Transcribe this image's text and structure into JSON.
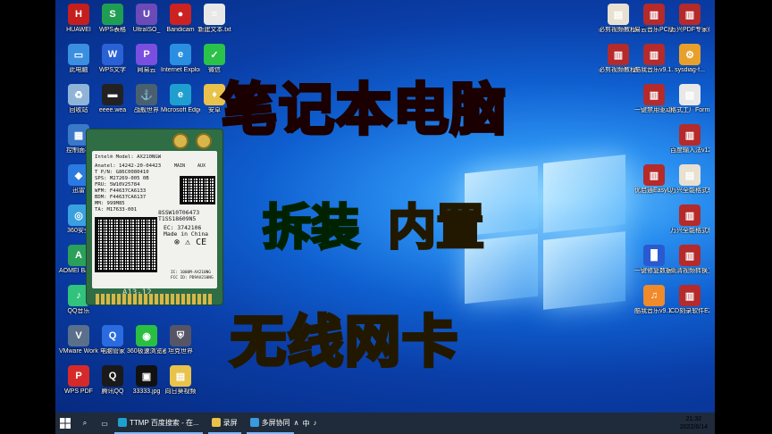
{
  "desktop_icons_left": [
    {
      "label": "HUAWEI",
      "color": "#c41e1e",
      "glyph": "H",
      "col": 0,
      "row": 0
    },
    {
      "label": "WPS表格",
      "color": "#1f9e53",
      "glyph": "S",
      "col": 1,
      "row": 0
    },
    {
      "label": "UltraISO_",
      "color": "#6a4bb8",
      "glyph": "U",
      "col": 2,
      "row": 0
    },
    {
      "label": "Bandicam",
      "color": "#c22",
      "glyph": "●",
      "col": 3,
      "row": 0
    },
    {
      "label": "新建文本.txt",
      "color": "#e8e8e8",
      "glyph": "≡",
      "col": 4,
      "row": 0
    },
    {
      "label": "此电脑",
      "color": "#3a8fe0",
      "glyph": "▭",
      "col": 0,
      "row": 1
    },
    {
      "label": "WPS文字",
      "color": "#2a62d6",
      "glyph": "W",
      "col": 1,
      "row": 1
    },
    {
      "label": "网易云",
      "color": "#7a4fe0",
      "glyph": "P",
      "col": 2,
      "row": 1
    },
    {
      "label": "Internet Explorer",
      "color": "#2a8fe0",
      "glyph": "e",
      "col": 3,
      "row": 1
    },
    {
      "label": "微信",
      "color": "#2bc24a",
      "glyph": "✓",
      "col": 4,
      "row": 1
    },
    {
      "label": "回收站",
      "color": "#8fb4d8",
      "glyph": "♻",
      "col": 0,
      "row": 2
    },
    {
      "label": "eeee.wea",
      "color": "#222",
      "glyph": "▬",
      "col": 1,
      "row": 2
    },
    {
      "label": "战舰世界",
      "color": "#4a6070",
      "glyph": "⚓",
      "col": 2,
      "row": 2
    },
    {
      "label": "Microsoft Edge",
      "color": "#1f9fd0",
      "glyph": "e",
      "col": 3,
      "row": 2
    },
    {
      "label": "安卓",
      "color": "#e8c24a",
      "glyph": "♦",
      "col": 4,
      "row": 2
    },
    {
      "label": "控制面板",
      "color": "#3a78c8",
      "glyph": "▦",
      "col": 0,
      "row": 3
    },
    {
      "label": "迅雷",
      "color": "#2a7ae0",
      "glyph": "◆",
      "col": 0,
      "row": 4
    },
    {
      "label": "360安全",
      "color": "#3aa0e0",
      "glyph": "◎",
      "col": 0,
      "row": 5
    },
    {
      "label": "AOMEI Backupper",
      "color": "#2aa05a",
      "glyph": "A",
      "col": 0,
      "row": 6
    },
    {
      "label": "QQ音乐",
      "color": "#31c27c",
      "glyph": "♪",
      "col": 0,
      "row": 7
    },
    {
      "label": "VMware Workstati",
      "color": "#5a6f8a",
      "glyph": "V",
      "col": 0,
      "row": 8
    },
    {
      "label": "电脑管家",
      "color": "#2a6ce0",
      "glyph": "Q",
      "col": 1,
      "row": 8
    },
    {
      "label": "360极速浏览器",
      "color": "#2abf40",
      "glyph": "◉",
      "col": 2,
      "row": 8
    },
    {
      "label": "坦克世界",
      "color": "#556",
      "glyph": "⛨",
      "col": 3,
      "row": 8
    },
    {
      "label": "WPS PDF",
      "color": "#d62a2a",
      "glyph": "P",
      "col": 0,
      "row": 9
    },
    {
      "label": "腾讯QQ",
      "color": "#1a1a1a",
      "glyph": "Q",
      "col": 1,
      "row": 9
    },
    {
      "label": "33333.jpg",
      "color": "#111",
      "glyph": "▣",
      "col": 2,
      "row": 9
    },
    {
      "label": "向日葵视频",
      "color": "#e8c24a",
      "glyph": "▤",
      "col": 3,
      "row": 9
    }
  ],
  "desktop_icons_right": [
    {
      "label": "必剪视频教程Bing...",
      "color": "#e8e0d0",
      "glyph": "▤",
      "col": 0,
      "row": 0
    },
    {
      "label": "易云音乐PC版_v2.7.5...",
      "color": "#b52a2a",
      "glyph": "▥",
      "col": 1,
      "row": 0
    },
    {
      "label": "万兴PDF专家破解版P",
      "color": "#b52a2a",
      "glyph": "▥",
      "col": 2,
      "row": 0
    },
    {
      "label": "必剪视频教程Bing_W...",
      "color": "#b52a2a",
      "glyph": "▥",
      "col": 0,
      "row": 1
    },
    {
      "label": "酷我音乐v9.1.1.4付...",
      "color": "#b52a2a",
      "glyph": "▥",
      "col": 1,
      "row": 1
    },
    {
      "label": "sysdiag-f...",
      "color": "#e8a02a",
      "glyph": "⚙",
      "col": 2,
      "row": 1
    },
    {
      "label": "一键禁用驱动程序.rar",
      "color": "#b52a2a",
      "glyph": "▥",
      "col": 1,
      "row": 2
    },
    {
      "label": "格式工厂FormatFa...",
      "color": "#e8e8e8",
      "glyph": "▧",
      "col": 2,
      "row": 2
    },
    {
      "label": "百度输入法v12.1b(60...",
      "color": "#b52a2a",
      "glyph": "▥",
      "col": 2,
      "row": 3
    },
    {
      "label": "优启通EasyU_3.7...",
      "color": "#b52a2a",
      "glyph": "▥",
      "col": 1,
      "row": 4
    },
    {
      "label": "万兴全能格式转换工...",
      "color": "#e8e0d0",
      "glyph": "▤",
      "col": 2,
      "row": 4
    },
    {
      "label": "万兴全能格式转换工...",
      "color": "#b52a2a",
      "glyph": "▥",
      "col": 2,
      "row": 5
    },
    {
      "label": "一键修复数据恢复...",
      "color": "#2a5ad0",
      "glyph": "█",
      "col": 1,
      "row": 6
    },
    {
      "label": "高清视频转换工具...",
      "color": "#b52a2a",
      "glyph": "▥",
      "col": 2,
      "row": 6
    },
    {
      "label": "酷我音乐v9.1.1.4付...",
      "color": "#f08a2a",
      "glyph": "♫",
      "col": 1,
      "row": 7
    },
    {
      "label": "CD刻录软件EZCDA...",
      "color": "#b52a2a",
      "glyph": "▥",
      "col": 2,
      "row": 7
    }
  ],
  "headlines": {
    "line1": "笔记本电脑",
    "line2a": "拆装",
    "line2b": "内置",
    "line3": "无线网卡"
  },
  "card": {
    "model": "Intel® Model: AX210NGW",
    "anatel": "Anatel: 14242-20-04423",
    "tpn": "T P/N: G86C0080410",
    "sps": "SPS: M27269-005 0B",
    "fru": "FRU: 5W10V25784",
    "wfm": "WFM: F44637CA6133",
    "bdm": "BDM: F44637CA6137",
    "mm": "MM: 999M85",
    "ta": "TA: M17633-001",
    "sn1": "8SSW10T06473",
    "sn2": "T1SS18609N5",
    "ec": "EC: 3742106",
    "made": "Made in China",
    "main": "MAIN",
    "aux": "AUX",
    "ic": "IC: 1000M-AX210NG",
    "fcc": "FCC ID: PD9AX210NG",
    "slot": "A13-12"
  },
  "taskbar": {
    "apps": [
      {
        "label": "TTMP 百度搜索 - 在...",
        "color": "#1f9fd0"
      },
      {
        "label": "录屏",
        "color": "#e8c24a"
      },
      {
        "label": "多屏协同",
        "color": "#3a9ae0"
      }
    ],
    "tray": [
      "∧",
      "中",
      "♪"
    ],
    "time": "21:32",
    "date": "2022/6/14"
  }
}
